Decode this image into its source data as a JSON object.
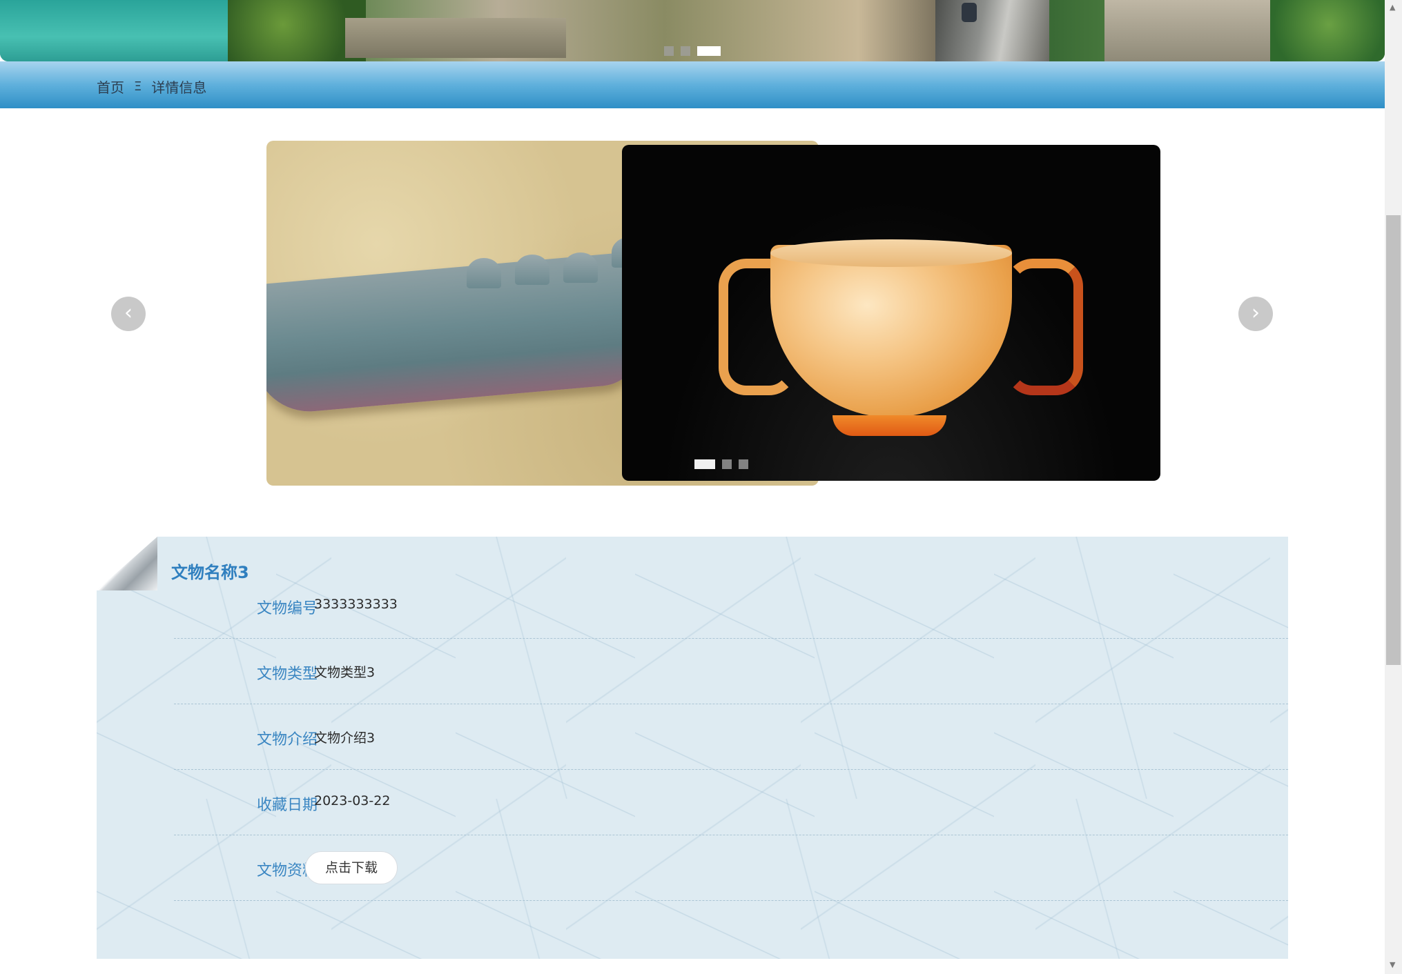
{
  "banner": {
    "slide_count": 3,
    "active_slide": 3
  },
  "breadcrumb": {
    "home": "首页",
    "separator": "Ξ",
    "current": "详情信息"
  },
  "carousel": {
    "slide_count": 3,
    "active_slide": 1,
    "prev_icon": "chevron-left-icon",
    "next_icon": "chevron-right-icon",
    "prev_glyph": "‹",
    "next_glyph": "›"
  },
  "detail": {
    "title": "文物名称3",
    "fields": [
      {
        "label": "文物编号",
        "value": "3333333333"
      },
      {
        "label": "文物类型",
        "value": "文物类型3"
      },
      {
        "label": "文物介绍",
        "value": "文物介绍3"
      },
      {
        "label": "收藏日期",
        "value": "2023-03-22"
      },
      {
        "label": "文物资料",
        "button": "点击下载"
      }
    ]
  },
  "colors": {
    "accent": "#2f7fbf",
    "label": "#3a86c2",
    "panel_bg": "#deebf2",
    "header_bar_top": "#a8d4ee",
    "header_bar_bottom": "#2f8fc6"
  }
}
